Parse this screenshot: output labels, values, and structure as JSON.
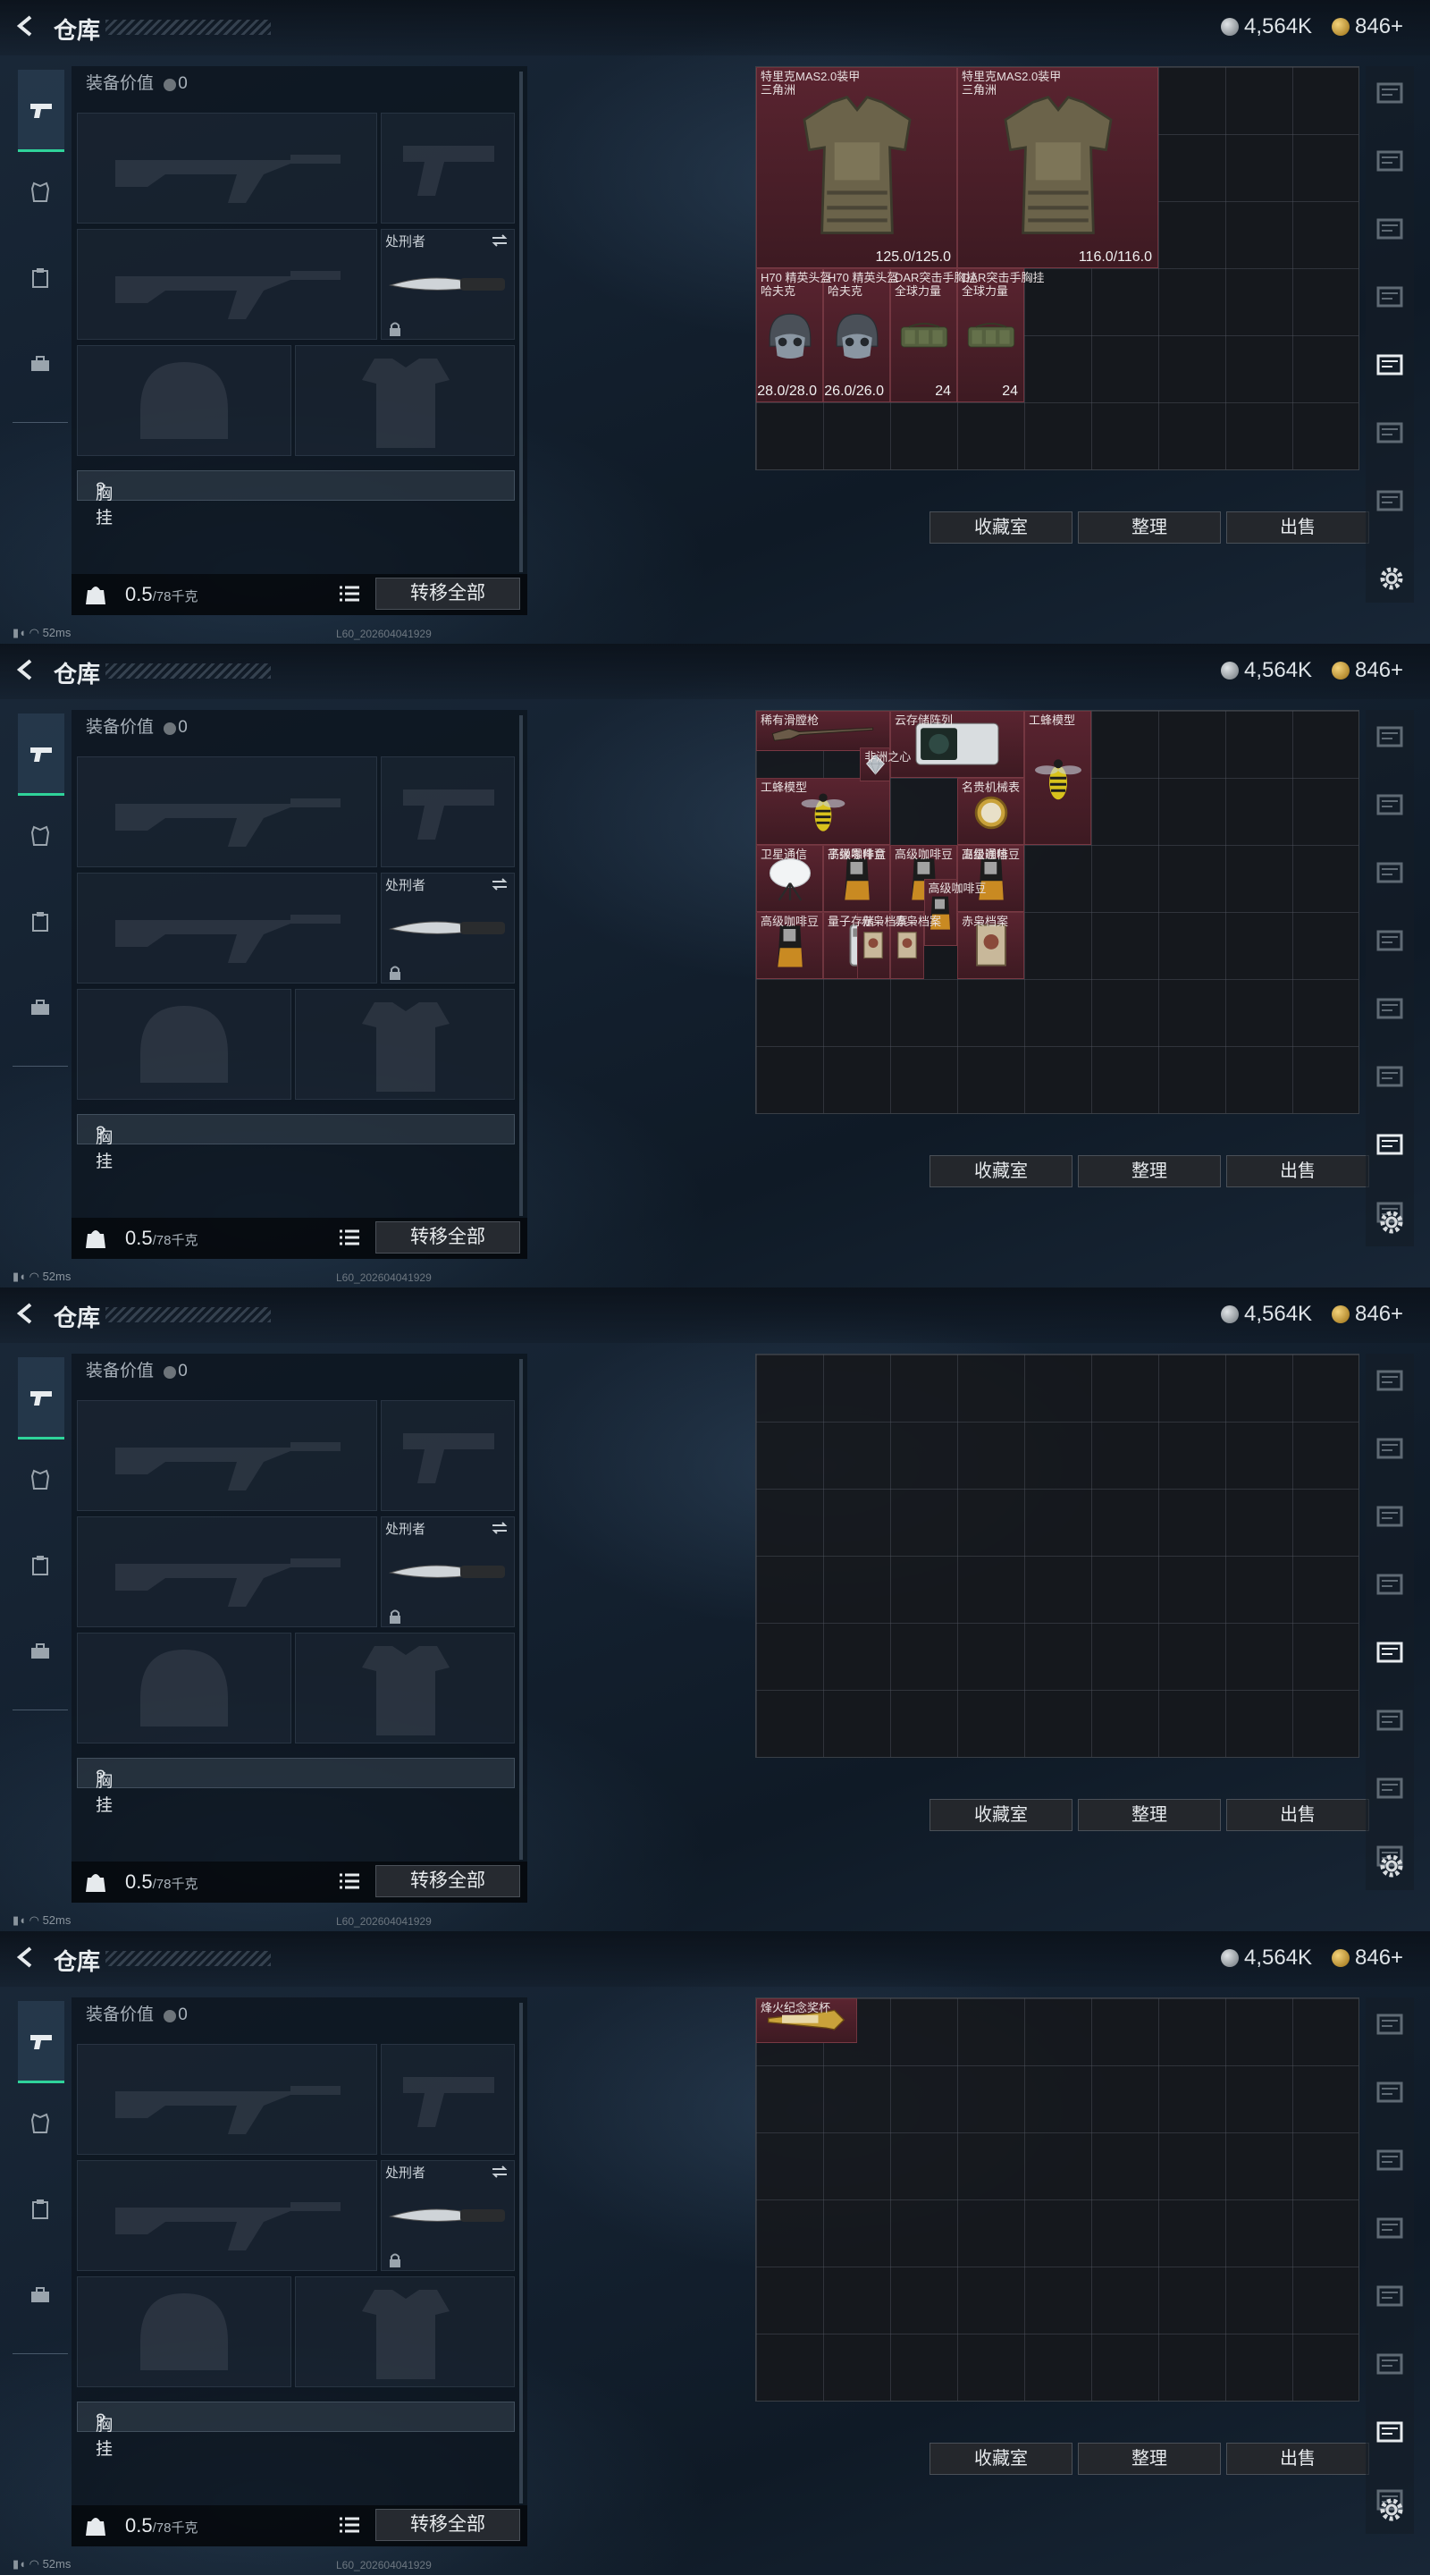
{
  "header": {
    "title": "仓库",
    "currency1": "4,564K",
    "currency2": "846+"
  },
  "left": {
    "equip_value_label": "装备价值",
    "equip_value": "0",
    "knife_label": "处刑者",
    "chest_label": "胸挂",
    "chest_hint": "?",
    "weight_value": "0.5",
    "weight_max": "/78千克",
    "transfer_all": "转移全部"
  },
  "buttons": {
    "collection": "收藏室",
    "organize": "整理",
    "sell": "出售"
  },
  "status": {
    "ping": "52ms",
    "build": "L60_202604041929"
  },
  "frames": [
    {
      "items": [
        {
          "name": "特里克MAS2.0装甲\n三角洲",
          "value": "125.0/125.0",
          "icon": "armor-icon"
        },
        {
          "name": "特里克MAS2.0装甲\n三角洲",
          "value": "116.0/116.0",
          "icon": "armor-icon"
        },
        {
          "name": "H70 精英头盔\n哈夫克",
          "value": "28.0/28.0",
          "icon": "helmet-icon"
        },
        {
          "name": "H70 精英头盔\n哈夫克",
          "value": "26.0/26.0",
          "icon": "helmet-icon"
        },
        {
          "name": "DAR突击手胸挂\n全球力量",
          "value": "24",
          "icon": "chest-rig-icon"
        },
        {
          "name": "DAR突击手胸挂\n全球力量",
          "value": "24",
          "icon": "chest-rig-icon"
        }
      ]
    },
    {
      "items": [
        {
          "name": "稀有滑膛枪",
          "value": "",
          "icon": "musket-icon"
        },
        {
          "name": "云存储阵列",
          "value": "",
          "icon": "server-icon"
        },
        {
          "name": "工蜂模型",
          "value": "",
          "icon": "wasp-icon"
        },
        {
          "name": "工蜂模型",
          "value": "",
          "icon": "wasp-icon"
        },
        {
          "name": "非洲之心",
          "value": "",
          "icon": "diamond-icon"
        },
        {
          "name": "子弹零件盒",
          "value": "",
          "icon": "parts-box-icon"
        },
        {
          "name": "名贵机械表",
          "value": "",
          "icon": "watch-icon"
        },
        {
          "name": "卫星通信",
          "value": "",
          "icon": "satellite-icon"
        },
        {
          "name": "卫星通信",
          "value": "",
          "icon": "satellite-icon"
        },
        {
          "name": "高级咖啡豆",
          "value": "",
          "icon": "coffee-icon"
        },
        {
          "name": "高级咖啡豆",
          "value": "",
          "icon": "coffee-icon"
        },
        {
          "name": "高级咖啡豆",
          "value": "",
          "icon": "coffee-icon"
        },
        {
          "name": "高级咖啡豆",
          "value": "",
          "icon": "coffee-icon"
        },
        {
          "name": "高级咖啡豆",
          "value": "",
          "icon": "coffee-icon"
        },
        {
          "name": "量子存储",
          "value": "",
          "icon": "usb-icon"
        },
        {
          "name": "赤枭档案",
          "value": "",
          "icon": "file-icon"
        },
        {
          "name": "赤枭档案",
          "value": "",
          "icon": "file-icon"
        },
        {
          "name": "赤枭档案",
          "value": "",
          "icon": "file-icon"
        }
      ]
    },
    {
      "items": []
    },
    {
      "items": [
        {
          "name": "烽火纪念奖杯",
          "value": "",
          "icon": "trophy-icon"
        }
      ]
    }
  ],
  "colors": {
    "accent": "#2fd39a",
    "item_bg": "#5a2430",
    "grid_bg": "#16181c"
  }
}
